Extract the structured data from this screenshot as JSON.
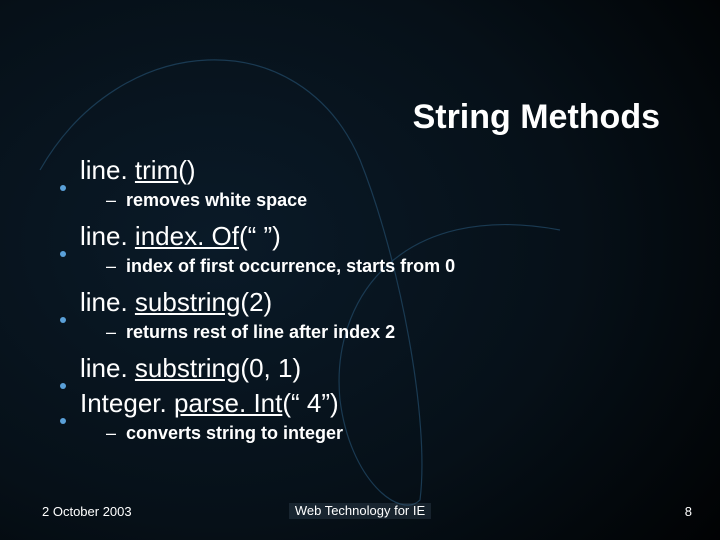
{
  "title": "String Methods",
  "items": [
    {
      "prefix": "line. ",
      "method": "trim",
      "suffix": "()",
      "sub": "removes white space"
    },
    {
      "prefix": "line. ",
      "method": "index. Of",
      "suffix": "(“ ”)",
      "sub": "index of first occurrence, starts from 0"
    },
    {
      "prefix": "line. ",
      "method": "substring",
      "suffix": "(2)",
      "sub": "returns rest of line after index 2"
    },
    {
      "prefix": "line. ",
      "method": "substring",
      "suffix": "(0, 1)",
      "sub": null
    },
    {
      "prefix": "Integer. ",
      "method": "parse. Int",
      "suffix": "(“ 4”)",
      "sub": "converts string to integer"
    }
  ],
  "footer": {
    "date": "2 October 2003",
    "center": "Web Technology for IE",
    "page": "8"
  }
}
